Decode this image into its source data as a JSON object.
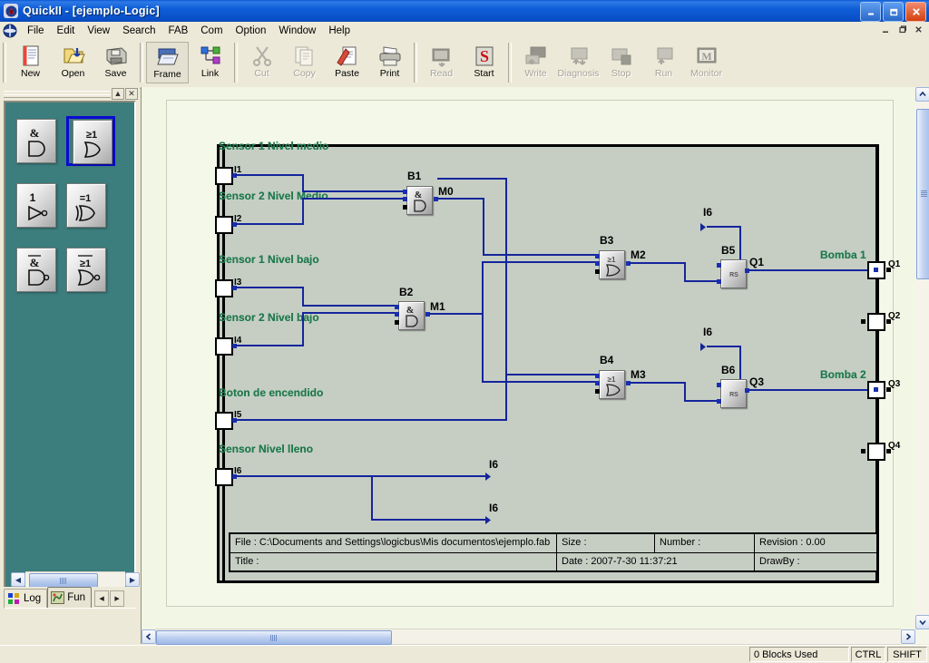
{
  "window": {
    "title": "QuickII - [ejemplo-Logic]",
    "app_icon": "quickii-logo-icon",
    "minimize_label": "–",
    "maximize_label": "❐",
    "close_label": "✕",
    "mdi_minimize_label": "–",
    "mdi_restore_label": "❐",
    "mdi_close_label": "✕"
  },
  "menu": {
    "icon": "quickii-menu-icon",
    "items": [
      {
        "label": "File"
      },
      {
        "label": "Edit"
      },
      {
        "label": "View"
      },
      {
        "label": "Search"
      },
      {
        "label": "FAB"
      },
      {
        "label": "Com"
      },
      {
        "label": "Option"
      },
      {
        "label": "Window"
      },
      {
        "label": "Help"
      }
    ]
  },
  "toolbar": {
    "groups": [
      {
        "buttons": [
          {
            "label": "New",
            "icon": "new-document-icon",
            "enabled": true,
            "selected": false
          },
          {
            "label": "Open",
            "icon": "open-folder-icon",
            "enabled": true,
            "selected": false
          },
          {
            "label": "Save",
            "icon": "floppy-disk-icon",
            "enabled": true,
            "selected": false
          }
        ]
      },
      {
        "buttons": [
          {
            "label": "Frame",
            "icon": "frame-icon",
            "enabled": true,
            "selected": true
          },
          {
            "label": "Link",
            "icon": "link-nodes-icon",
            "enabled": true,
            "selected": false
          }
        ]
      },
      {
        "buttons": [
          {
            "label": "Cut",
            "icon": "scissors-icon",
            "enabled": false,
            "selected": false
          },
          {
            "label": "Copy",
            "icon": "copy-pages-icon",
            "enabled": false,
            "selected": false
          },
          {
            "label": "Paste",
            "icon": "paste-clipboard-icon",
            "enabled": true,
            "selected": false
          },
          {
            "label": "Print",
            "icon": "printer-icon",
            "enabled": true,
            "selected": false
          }
        ]
      },
      {
        "buttons": [
          {
            "label": "Read",
            "icon": "read-device-icon",
            "enabled": false,
            "selected": false
          },
          {
            "label": "Start",
            "icon": "start-icon",
            "enabled": true,
            "selected": false
          }
        ]
      },
      {
        "buttons": [
          {
            "label": "Write",
            "icon": "write-device-icon",
            "enabled": false,
            "selected": false
          },
          {
            "label": "Diagnosis",
            "icon": "diagnosis-icon",
            "enabled": false,
            "selected": false
          },
          {
            "label": "Stop",
            "icon": "stop-icon",
            "enabled": false,
            "selected": false
          },
          {
            "label": "Run",
            "icon": "run-icon",
            "enabled": false,
            "selected": false
          },
          {
            "label": "Monitor",
            "icon": "monitor-icon",
            "enabled": false,
            "selected": false
          }
        ]
      }
    ]
  },
  "palette": {
    "collapse_label": "▲",
    "close_label": "✕",
    "gates": [
      {
        "name": "and-gate",
        "top_symbol": "&",
        "inverted": false,
        "selected": false
      },
      {
        "name": "or-gate",
        "top_symbol": "≥1",
        "inverted": false,
        "selected": true
      },
      {
        "name": "not-gate",
        "top_symbol": "1",
        "inverted": true,
        "selected": false
      },
      {
        "name": "xor-gate",
        "top_symbol": "=1",
        "inverted": false,
        "selected": false
      },
      {
        "name": "nand-gate",
        "top_symbol": "&",
        "inverted": true,
        "selected": false
      },
      {
        "name": "nor-gate",
        "top_symbol": "≥1",
        "inverted": true,
        "selected": false
      }
    ],
    "scroll_left": "◀",
    "scroll_right": "▶"
  },
  "tabs": {
    "items": [
      {
        "label": "Log",
        "icon": "log-blocks-icon",
        "active": false
      },
      {
        "label": "Fun",
        "icon": "fun-function-icon",
        "active": true
      }
    ],
    "prev_label": "◀",
    "next_label": "▶"
  },
  "diagram": {
    "inputs": [
      {
        "id": "I1",
        "label": "Sensor 1 Nivel medio"
      },
      {
        "id": "I2",
        "label": "Sensor 2 Nivel Medio"
      },
      {
        "id": "I3",
        "label": "Sensor 1 Nivel bajo"
      },
      {
        "id": "I4",
        "label": "Sensor 2 Nivel bajo"
      },
      {
        "id": "I5",
        "label": "Boton de encendido"
      },
      {
        "id": "I6",
        "label": "Sensor Nivel lleno"
      }
    ],
    "blocks": [
      {
        "id": "B1",
        "type": "AND",
        "symbol": "&",
        "output": "M0"
      },
      {
        "id": "B2",
        "type": "AND",
        "symbol": "&",
        "output": "M1"
      },
      {
        "id": "B3",
        "type": "OR",
        "symbol": "≥1",
        "output": "M2"
      },
      {
        "id": "B4",
        "type": "OR",
        "symbol": "≥1",
        "output": "M3"
      },
      {
        "id": "B5",
        "type": "RS",
        "symbol": "RS",
        "output": "Q1"
      },
      {
        "id": "B6",
        "type": "RS",
        "symbol": "RS",
        "output": "Q3"
      }
    ],
    "connectors": [
      {
        "id": "I6"
      },
      {
        "id": "I6"
      }
    ],
    "outputs": [
      {
        "id": "Q1",
        "label": "Bomba 1"
      },
      {
        "id": "Q2",
        "label": ""
      },
      {
        "id": "Q3",
        "label": "Bomba 2"
      },
      {
        "id": "Q4",
        "label": ""
      }
    ],
    "titleblock": {
      "file": "File : C:\\Documents and Settings\\logicbus\\Mis documentos\\ejemplo.fab",
      "size": "Size :",
      "number": "Number :",
      "revision": "Revision :  0.00",
      "title": "Title :",
      "date": "Date : 2007-7-30 11:37:21",
      "drawby": "DrawBy :"
    }
  },
  "statusbar": {
    "message": "",
    "blocks_used": "0 Blocks Used",
    "ctrl": "CTRL",
    "shift": "SHIFT"
  }
}
